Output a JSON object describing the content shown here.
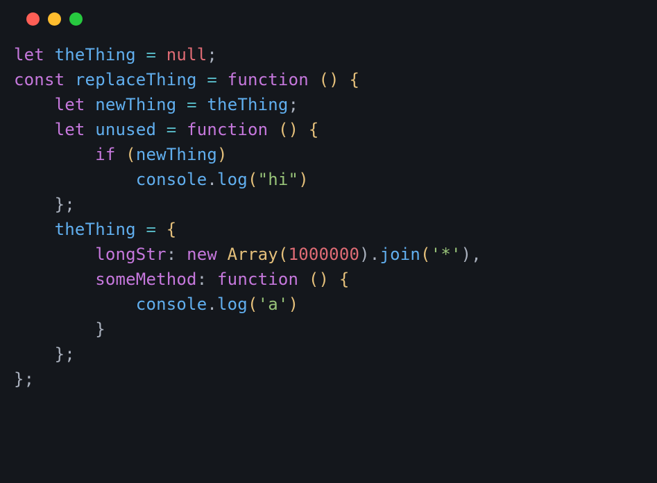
{
  "window": {
    "buttons": {
      "close": "close",
      "minimize": "minimize",
      "maximize": "maximize"
    }
  },
  "code": {
    "line1": {
      "t0": "let",
      "t1": " ",
      "t2": "theThing",
      "t3": " ",
      "t4": "=",
      "t5": " ",
      "t6": "null",
      "t7": ";"
    },
    "line2": {
      "t0": "const",
      "t1": " ",
      "t2": "replaceThing",
      "t3": " ",
      "t4": "=",
      "t5": " ",
      "t6": "function",
      "t7": " ",
      "t8": "()",
      "t9": " ",
      "t10": "{"
    },
    "line3": {
      "indent": "    ",
      "t0": "let",
      "t1": " ",
      "t2": "newThing",
      "t3": " ",
      "t4": "=",
      "t5": " ",
      "t6": "theThing",
      "t7": ";"
    },
    "line4": {
      "indent": "    ",
      "t0": "let",
      "t1": " ",
      "t2": "unused",
      "t3": " ",
      "t4": "=",
      "t5": " ",
      "t6": "function",
      "t7": " ",
      "t8": "()",
      "t9": " ",
      "t10": "{"
    },
    "line5": {
      "indent": "        ",
      "t0": "if",
      "t1": " ",
      "t2": "(",
      "t3": "newThing",
      "t4": ")"
    },
    "line6": {
      "indent": "            ",
      "t0": "console",
      "t1": ".",
      "t2": "log",
      "t3": "(",
      "t4": "\"hi\"",
      "t5": ")"
    },
    "line7": {
      "indent": "    ",
      "t0": "};"
    },
    "line8": {
      "indent": "    ",
      "t0": "theThing",
      "t1": " ",
      "t2": "=",
      "t3": " ",
      "t4": "{"
    },
    "line9": {
      "indent": "        ",
      "t0": "longStr",
      "t1": ":",
      "t2": " ",
      "t3": "new",
      "t4": " ",
      "t5": "Array",
      "t6": "(",
      "t7": "1000000",
      "t8": ").",
      "t9": "join",
      "t10": "(",
      "t11": "'*'",
      "t12": "),"
    },
    "line10": {
      "indent": "        ",
      "t0": "someMethod",
      "t1": ":",
      "t2": " ",
      "t3": "function",
      "t4": " ",
      "t5": "()",
      "t6": " ",
      "t7": "{"
    },
    "line11": {
      "indent": "            ",
      "t0": "console",
      "t1": ".",
      "t2": "log",
      "t3": "(",
      "t4": "'a'",
      "t5": ")"
    },
    "line12": {
      "indent": "        ",
      "t0": "}"
    },
    "line13": {
      "indent": "    ",
      "t0": "};"
    },
    "line14": {
      "t0": "};"
    }
  }
}
